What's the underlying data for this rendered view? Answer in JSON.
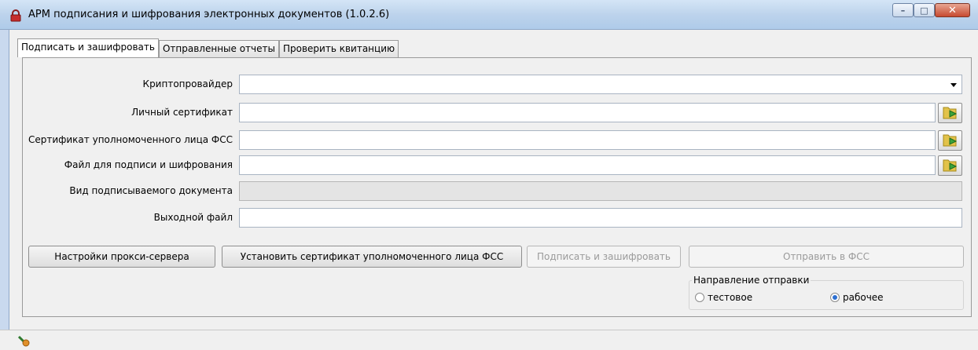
{
  "window": {
    "title": "АРМ подписания и шифрования электронных документов (1.0.2.6)",
    "app_icon": "lock-icon",
    "controls": {
      "minimize": "–",
      "maximize": "□",
      "close": "✕"
    }
  },
  "tabs": [
    {
      "label": "Подписать и зашифровать",
      "active": true
    },
    {
      "label": "Отправленные отчеты",
      "active": false
    },
    {
      "label": "Проверить квитанцию",
      "active": false
    }
  ],
  "form": {
    "crypto_provider": {
      "label": "Криптопровайдер",
      "value": ""
    },
    "personal_cert": {
      "label": "Личный сертификат",
      "value": ""
    },
    "fss_cert": {
      "label": "Сертификат уполномоченного лица ФСС",
      "value": ""
    },
    "sign_file": {
      "label": "Файл для подписи и шифрования",
      "value": ""
    },
    "doc_type": {
      "label": "Вид подписываемого документа",
      "value": ""
    },
    "output_file": {
      "label": "Выходной файл",
      "value": ""
    },
    "browse_icon": "open-folder-icon"
  },
  "buttons": {
    "proxy": "Настройки прокси-сервера",
    "install_cert": "Установить сертификат уполномоченного лица ФСС",
    "sign_encrypt": "Подписать и зашифровать",
    "send": "Отправить в ФСС"
  },
  "direction": {
    "title": "Направление отправки",
    "options": [
      {
        "label": "тестовое",
        "selected": false
      },
      {
        "label": "рабочее",
        "selected": true
      }
    ]
  },
  "status": {
    "icon": "connection-icon"
  },
  "colors": {
    "radio_selected": "#2d6fd1",
    "title_bar": "#bdd3ec",
    "window_bg": "#f0f0f0"
  }
}
